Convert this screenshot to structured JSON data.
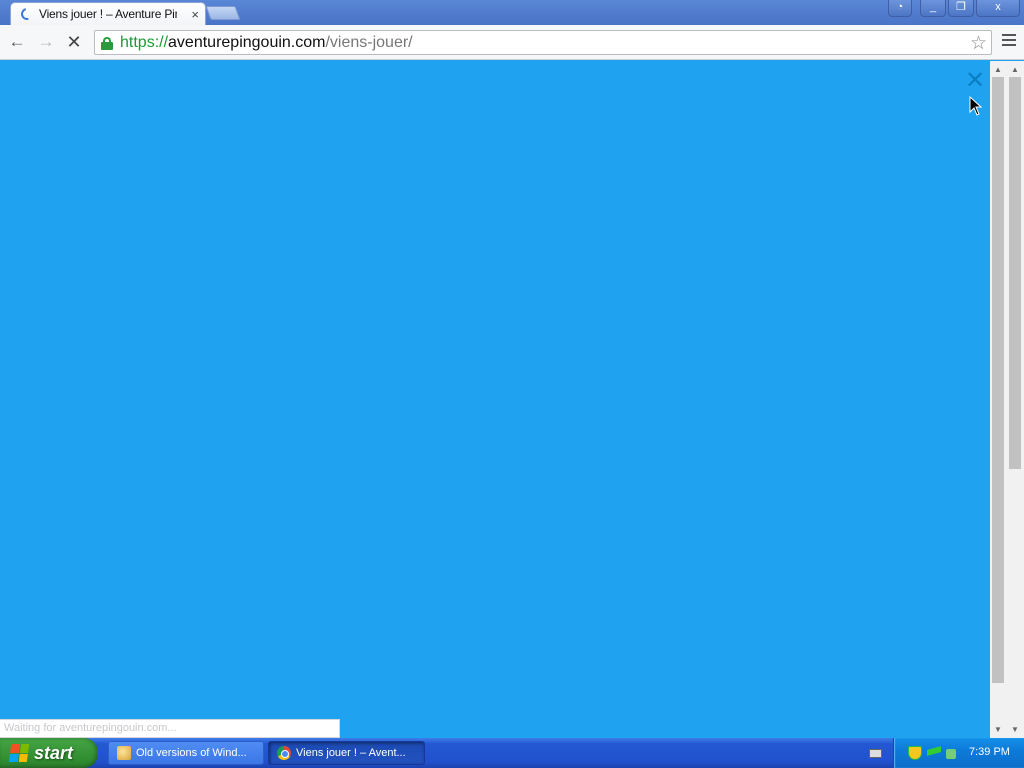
{
  "browser": {
    "tab_title": "Viens jouer ! – Aventure Pingouin",
    "tab_close": "×",
    "window_buttons": {
      "user": "◔",
      "minimize": "_",
      "restore": "❐",
      "close": "x"
    },
    "toolbar": {
      "back": "←",
      "forward": "→",
      "stop": "✕",
      "url": {
        "scheme": "https://",
        "host": "aventurepingouin.com",
        "path": "/viens-jouer/"
      },
      "bookmark_star": "☆"
    }
  },
  "page": {
    "background_color": "#1fa3f0",
    "overlay_close": "✕"
  },
  "status_bubble": "Waiting for aventurepingouin.com...",
  "taskbar": {
    "start_label": "start",
    "tasks": [
      {
        "label": "Old versions of Wind...",
        "icon": "app-icon",
        "active": false
      },
      {
        "label": "Viens jouer ! – Avent...",
        "icon": "chrome-icon",
        "active": true
      }
    ],
    "clock": "7:39 PM"
  },
  "icons": {
    "lock": "lock-icon",
    "star": "star-icon",
    "menu": "menu-icon",
    "spinner": "loading-spinner-icon"
  }
}
